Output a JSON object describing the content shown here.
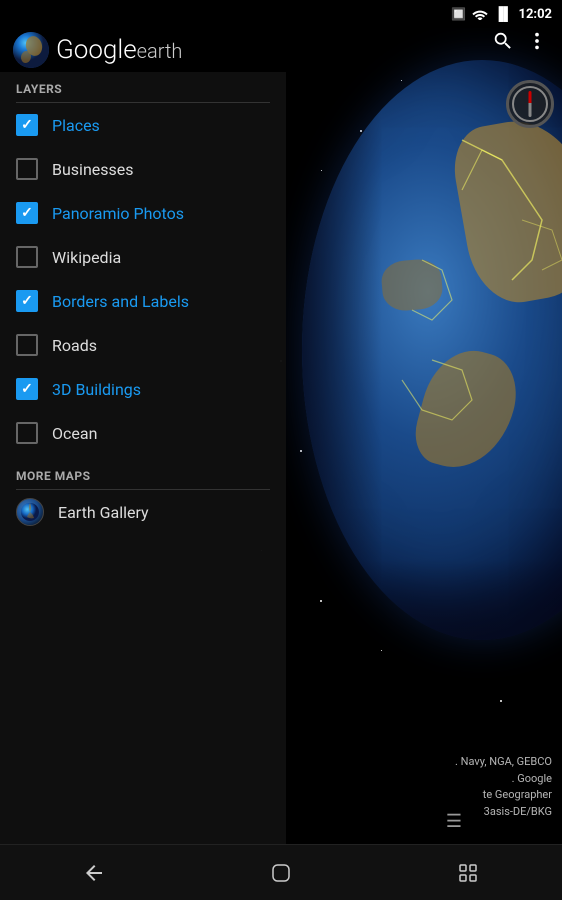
{
  "app": {
    "title": "Google earth",
    "logo_google": "Google",
    "logo_earth": "earth"
  },
  "statusBar": {
    "time": "12:02",
    "bluetooth_icon": "bluetooth-icon",
    "wifi_icon": "wifi-icon",
    "battery_icon": "battery-icon"
  },
  "topActions": {
    "search_label": "🔍",
    "menu_label": "⋮"
  },
  "sections": {
    "layers_label": "LAYERS",
    "more_maps_label": "MORE MAPS"
  },
  "layers": [
    {
      "id": "places",
      "name": "Places",
      "checked": true,
      "active": true
    },
    {
      "id": "businesses",
      "name": "Businesses",
      "checked": false,
      "active": false
    },
    {
      "id": "panoramio",
      "name": "Panoramio Photos",
      "checked": true,
      "active": true
    },
    {
      "id": "wikipedia",
      "name": "Wikipedia",
      "checked": false,
      "active": false
    },
    {
      "id": "borders",
      "name": "Borders and Labels",
      "checked": true,
      "active": true
    },
    {
      "id": "roads",
      "name": "Roads",
      "checked": false,
      "active": false
    },
    {
      "id": "buildings",
      "name": "3D Buildings",
      "checked": true,
      "active": true
    },
    {
      "id": "ocean",
      "name": "Ocean",
      "checked": false,
      "active": false
    }
  ],
  "moreMaps": [
    {
      "id": "earth-gallery",
      "name": "Earth Gallery",
      "icon": "globe-icon"
    }
  ],
  "attribution": {
    "lines": [
      ". Navy, NGA, GEBCO",
      ". Google",
      "te Geographer",
      "3asis-DE/BKG"
    ]
  },
  "navBar": {
    "back_icon": "back-icon",
    "home_icon": "home-icon",
    "recents_icon": "recents-icon"
  }
}
